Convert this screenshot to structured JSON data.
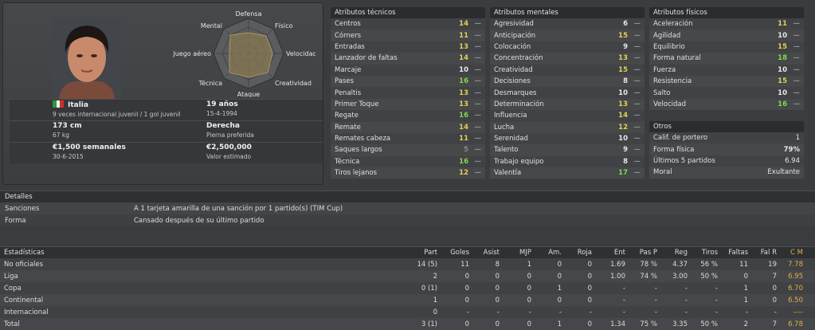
{
  "player": {
    "nationality": "Italia",
    "caps": "9 veces internacional juvenil / 1 gol juvenil",
    "age": "19 años",
    "birthdate": "15-4-1994",
    "height": "173 cm",
    "weight": "67 kg",
    "foot": "Derecha",
    "foot_label": "Pierna preferida",
    "wage": "€1,500 semanales",
    "contract_end": "30-6-2015",
    "value": "€2,500,000",
    "value_label": "Valor estimado"
  },
  "radar": {
    "labels": [
      "Defensa",
      "Físico",
      "Velocidad",
      "Creatividad",
      "Ataque",
      "Técnica",
      "Juego aéreo",
      "Mental"
    ]
  },
  "technical": {
    "title": "Atributos técnicos",
    "items": [
      {
        "name": "Centros",
        "value": "14"
      },
      {
        "name": "Córners",
        "value": "11"
      },
      {
        "name": "Entradas",
        "value": "13"
      },
      {
        "name": "Lanzador de faltas",
        "value": "14"
      },
      {
        "name": "Marcaje",
        "value": "10"
      },
      {
        "name": "Pases",
        "value": "16"
      },
      {
        "name": "Penaltis",
        "value": "13"
      },
      {
        "name": "Primer Toque",
        "value": "13"
      },
      {
        "name": "Regate",
        "value": "16"
      },
      {
        "name": "Remate",
        "value": "14"
      },
      {
        "name": "Remates cabeza",
        "value": "11"
      },
      {
        "name": "Saques largos",
        "value": "5"
      },
      {
        "name": "Técnica",
        "value": "16"
      },
      {
        "name": "Tiros lejanos",
        "value": "12"
      }
    ]
  },
  "mental": {
    "title": "Atributos mentales",
    "items": [
      {
        "name": "Agresividad",
        "value": "6"
      },
      {
        "name": "Anticipación",
        "value": "15"
      },
      {
        "name": "Colocación",
        "value": "9"
      },
      {
        "name": "Concentración",
        "value": "13"
      },
      {
        "name": "Creatividad",
        "value": "15"
      },
      {
        "name": "Decisiones",
        "value": "8"
      },
      {
        "name": "Desmarques",
        "value": "10"
      },
      {
        "name": "Determinación",
        "value": "13"
      },
      {
        "name": "Influencia",
        "value": "14"
      },
      {
        "name": "Lucha",
        "value": "12"
      },
      {
        "name": "Serenidad",
        "value": "10"
      },
      {
        "name": "Talento",
        "value": "9"
      },
      {
        "name": "Trabajo equipo",
        "value": "8"
      },
      {
        "name": "Valentía",
        "value": "17"
      }
    ]
  },
  "physical": {
    "title": "Atributos físicos",
    "items": [
      {
        "name": "Aceleración",
        "value": "11"
      },
      {
        "name": "Agilidad",
        "value": "10"
      },
      {
        "name": "Equilibrio",
        "value": "15"
      },
      {
        "name": "Forma natural",
        "value": "18"
      },
      {
        "name": "Fuerza",
        "value": "10"
      },
      {
        "name": "Resistencia",
        "value": "15"
      },
      {
        "name": "Salto",
        "value": "10"
      },
      {
        "name": "Velocidad",
        "value": "16"
      }
    ]
  },
  "otros": {
    "title": "Otros",
    "items": [
      {
        "name": "Calif. de portero",
        "value": "1"
      },
      {
        "name": "Forma física",
        "value": "79%"
      },
      {
        "name": "Últimos 5 partidos",
        "value": "6.94"
      },
      {
        "name": "Moral",
        "value": "Exultante"
      }
    ]
  },
  "detalles": {
    "title": "Detalles",
    "rows": [
      {
        "label": "Sanciones",
        "value": "A 1 tarjeta amarilla de una sanción por 1 partido(s) (TIM Cup)"
      },
      {
        "label": "Forma",
        "value": "Cansado después de su último partido"
      }
    ]
  },
  "stats": {
    "title": "Estadísticas",
    "columns": [
      "Part",
      "Goles",
      "Asist",
      "MJP",
      "Am.",
      "Roja",
      "Ent",
      "Pas P",
      "Reg",
      "Tiros",
      "Faltas",
      "Fal R",
      "C M"
    ],
    "rows": [
      {
        "name": "No oficiales",
        "cells": [
          "14 (5)",
          "11",
          "8",
          "1",
          "0",
          "0",
          "1.69",
          "78 %",
          "4.37",
          "56 %",
          "11",
          "19",
          "7.78"
        ]
      },
      {
        "name": "Liga",
        "cells": [
          "2",
          "0",
          "0",
          "0",
          "0",
          "0",
          "1.00",
          "74 %",
          "3.00",
          "50 %",
          "0",
          "7",
          "6.95"
        ]
      },
      {
        "name": "Copa",
        "cells": [
          "0 (1)",
          "0",
          "0",
          "0",
          "1",
          "0",
          "-",
          "-",
          "-",
          "-",
          "1",
          "0",
          "6.70"
        ]
      },
      {
        "name": "Continental",
        "cells": [
          "1",
          "0",
          "0",
          "0",
          "0",
          "0",
          "-",
          "-",
          "-",
          "-",
          "1",
          "0",
          "6.50"
        ]
      },
      {
        "name": "Internacional",
        "cells": [
          "0",
          "-",
          "-",
          "-",
          "-",
          "-",
          "-",
          "-",
          "-",
          "-",
          "-",
          "-",
          "----"
        ]
      },
      {
        "name": "Total",
        "cells": [
          "3 (1)",
          "0",
          "0",
          "0",
          "1",
          "0",
          "1.34",
          "75 %",
          "3.35",
          "50 %",
          "2",
          "7",
          "6.78"
        ]
      }
    ]
  },
  "colors": {
    "green_attr": "#80d850",
    "yellow_attr": "#e0d058",
    "rating": "#e0b040",
    "radar_fill": "#8a7a50"
  },
  "icons": [
    "italy-flag-icon",
    "player-face-photo",
    "attribute-radar-chart"
  ]
}
